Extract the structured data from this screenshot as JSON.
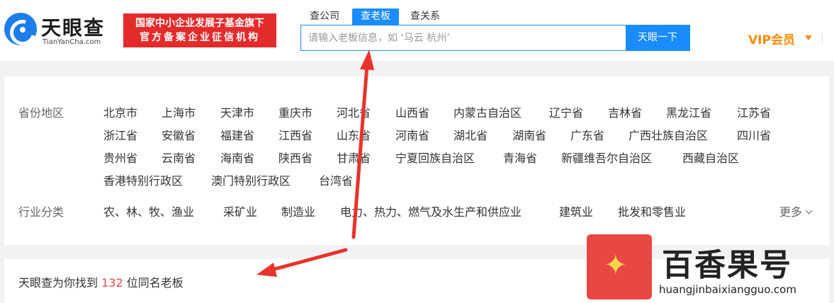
{
  "header": {
    "logo_text": "天眼查",
    "logo_en": "TianYanCha.com",
    "badge_line1": "国家中小企业发展子基金旗下",
    "badge_line2": "官方备案企业征信机构",
    "tabs": [
      {
        "label": "查公司",
        "active": false
      },
      {
        "label": "查老板",
        "active": true
      },
      {
        "label": "查关系",
        "active": false
      }
    ],
    "search_placeholder": "请输入老板信息，如 ‘马云 杭州’",
    "search_button": "天眼一下",
    "vip_label": "VIP会员"
  },
  "filters": {
    "region_label": "省份地区",
    "regions": [
      "北京市",
      "上海市",
      "天津市",
      "重庆市",
      "河北省",
      "山西省",
      "内蒙古自治区",
      "辽宁省",
      "吉林省",
      "黑龙江省",
      "江苏省",
      "浙江省",
      "安徽省",
      "福建省",
      "江西省",
      "山东省",
      "河南省",
      "湖北省",
      "湖南省",
      "广东省",
      "广西壮族自治区",
      "四川省",
      "贵州省",
      "云南省",
      "海南省",
      "陕西省",
      "甘肃省",
      "宁夏回族自治区",
      "青海省",
      "新疆维吾尔自治区",
      "西藏自治区",
      "香港特别行政区",
      "澳门特别行政区",
      "台湾省"
    ],
    "industry_label": "行业分类",
    "industries": [
      "农、林、牧、渔业",
      "采矿业",
      "制造业",
      "电力、热力、燃气及水生产和供应业",
      "建筑业",
      "批发和零售业"
    ],
    "more_label": "更多"
  },
  "result": {
    "prefix": "天眼查为你找到",
    "count": "132",
    "suffix": "位同名老板"
  },
  "watermark": {
    "name": "百香果号",
    "url": "huangjinbaixiangguo.com"
  },
  "colors": {
    "accent": "#1a8cff",
    "badge": "#e32b2b",
    "vip": "#ff8a00",
    "count": "#e24b4b",
    "arrow": "#e8332b"
  }
}
